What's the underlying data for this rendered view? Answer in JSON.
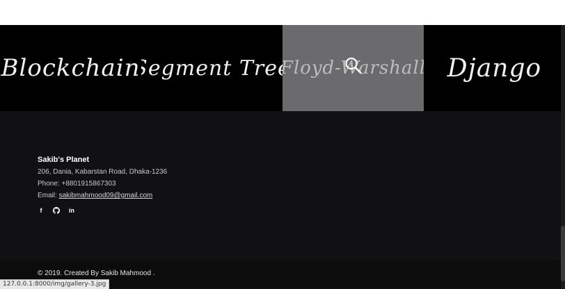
{
  "gallery": {
    "items": [
      {
        "label": "Blockchain"
      },
      {
        "label": "Segment Tree"
      },
      {
        "label": "Floyd-Warshall",
        "active": true
      },
      {
        "label": "Django"
      }
    ]
  },
  "footer": {
    "site_name": "Sakib's Planet",
    "address": "206, Dania, Kabarstan Road, Dhaka-1236",
    "phone": "Phone: +8801915867303",
    "email_prefix": "Email: ",
    "email": "sakibmahmood09@gmail.com",
    "social": {
      "facebook": "f",
      "linkedin": "in"
    }
  },
  "copyright": "© 2019. Created By Sakib Mahmood .",
  "status_url": "127.0.0.1:8000/img/gallery-3.jpg",
  "colors": {
    "gallery_bg": "#000000",
    "active_tile": "#6b6a6c",
    "footer_bg": "#111113"
  }
}
